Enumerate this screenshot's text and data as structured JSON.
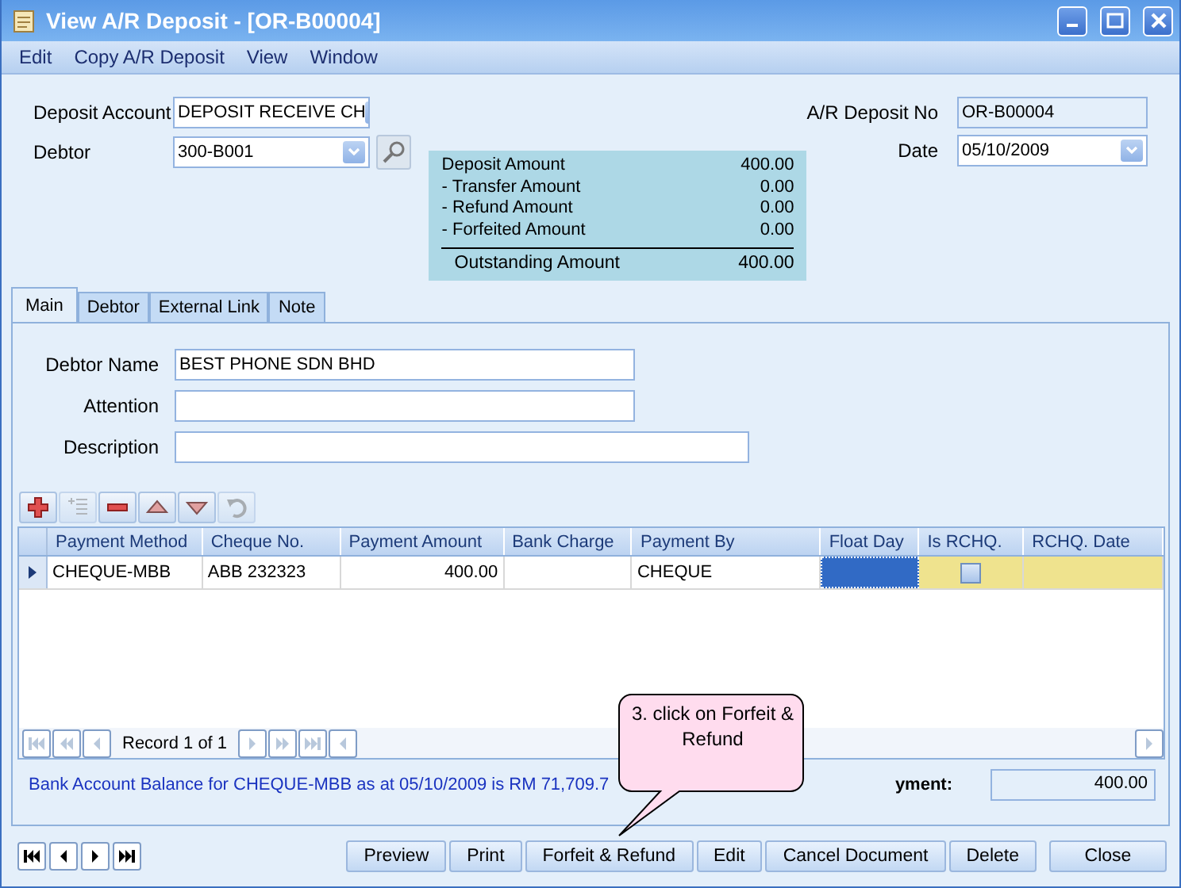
{
  "window": {
    "title": "View A/R Deposit - [OR-B00004]"
  },
  "menu": [
    "Edit",
    "Copy A/R Deposit",
    "View",
    "Window"
  ],
  "header": {
    "left_fields": [
      {
        "label": "Deposit Account",
        "value": "DEPOSIT RECEIVE CH",
        "kind": "dropdown"
      },
      {
        "label": "Debtor",
        "value": "300-B001",
        "kind": "lookup"
      }
    ],
    "right_fields": [
      {
        "label": "A/R Deposit No",
        "value": "OR-B00004",
        "kind": "text"
      },
      {
        "label": "Date",
        "value": "05/10/2009",
        "kind": "date"
      }
    ]
  },
  "summary": {
    "rows": [
      {
        "label": "Deposit Amount",
        "amount": "400.00"
      },
      {
        "label": "- Transfer Amount",
        "amount": "0.00"
      },
      {
        "label": "- Refund Amount",
        "amount": "0.00"
      },
      {
        "label": "- Forfeited Amount",
        "amount": "0.00"
      }
    ],
    "total": {
      "label": "Outstanding Amount",
      "amount": "400.00"
    }
  },
  "tabs": [
    {
      "label": "Main",
      "selected": true
    },
    {
      "label": "Debtor",
      "selected": false
    },
    {
      "label": "External Link",
      "selected": false
    },
    {
      "label": "Note",
      "selected": false
    }
  ],
  "main_tab": {
    "fields": [
      {
        "label": "Debtor Name",
        "value": "BEST PHONE SDN BHD",
        "kind": "short"
      },
      {
        "label": "Attention",
        "kind": "short"
      },
      {
        "label": "Description",
        "kind": "long"
      }
    ]
  },
  "grid_toolbar": [
    {
      "kind": "add",
      "disabled": false
    },
    {
      "kind": "insert",
      "disabled": true
    },
    {
      "kind": "remove",
      "disabled": false
    },
    {
      "kind": "up",
      "disabled": false
    },
    {
      "kind": "down",
      "disabled": false
    },
    {
      "kind": "undo",
      "disabled": true
    }
  ],
  "grid": {
    "columns": [
      "Payment Method",
      "Cheque No.",
      "Payment Amount",
      "Bank Charge",
      "Payment By",
      "Float Day",
      "Is RCHQ.",
      "RCHQ. Date"
    ],
    "rows": [
      {
        "selected": true,
        "payment_method": "CHEQUE-MBB",
        "cheque_no": "ABB 232323",
        "payment_amount": "400.00",
        "payment_by": "CHEQUE",
        "is_rchq": false
      }
    ],
    "record": "Record 1 of 1"
  },
  "info": {
    "text": "Bank Account Balance for CHEQUE-MBB as at 05/10/2009 is RM 71,709.7",
    "payment_label": "yment:",
    "payment_value": "400.00"
  },
  "buttons": [
    "Preview",
    "Print",
    "Forfeit & Refund",
    "Edit",
    "Cancel Document",
    "Delete",
    "Close"
  ],
  "callout": {
    "text": "3. click on Forfeit & Refund"
  }
}
